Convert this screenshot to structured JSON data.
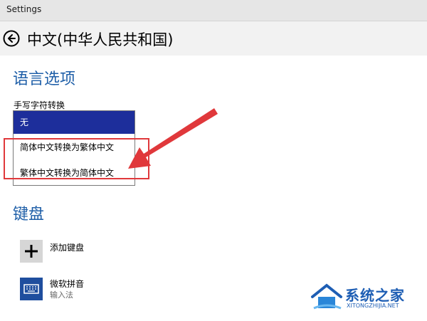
{
  "window": {
    "title": "Settings"
  },
  "header": {
    "page_title": "中文(中华人民共和国)",
    "back_icon": "back-arrow-icon"
  },
  "language_options": {
    "section_title": "语言选项",
    "handwriting": {
      "label": "手写字符转换",
      "options": [
        "无",
        "简体中文转换为繁体中文",
        "繁体中文转换为简体中文"
      ],
      "selected": "无"
    }
  },
  "keyboard": {
    "section_title": "键盘",
    "add_keyboard_label": "添加键盘",
    "keyboards": [
      {
        "name": "微软拼音",
        "type": "输入法",
        "icon": "keyboard-icon"
      }
    ]
  },
  "watermark": {
    "text": "系统之家",
    "url": "XITONGZHIJIA.NET"
  },
  "colors": {
    "accent": "#1f5fa8",
    "selected_option": "#1d2e9b",
    "annotation_red": "#e0383b"
  }
}
